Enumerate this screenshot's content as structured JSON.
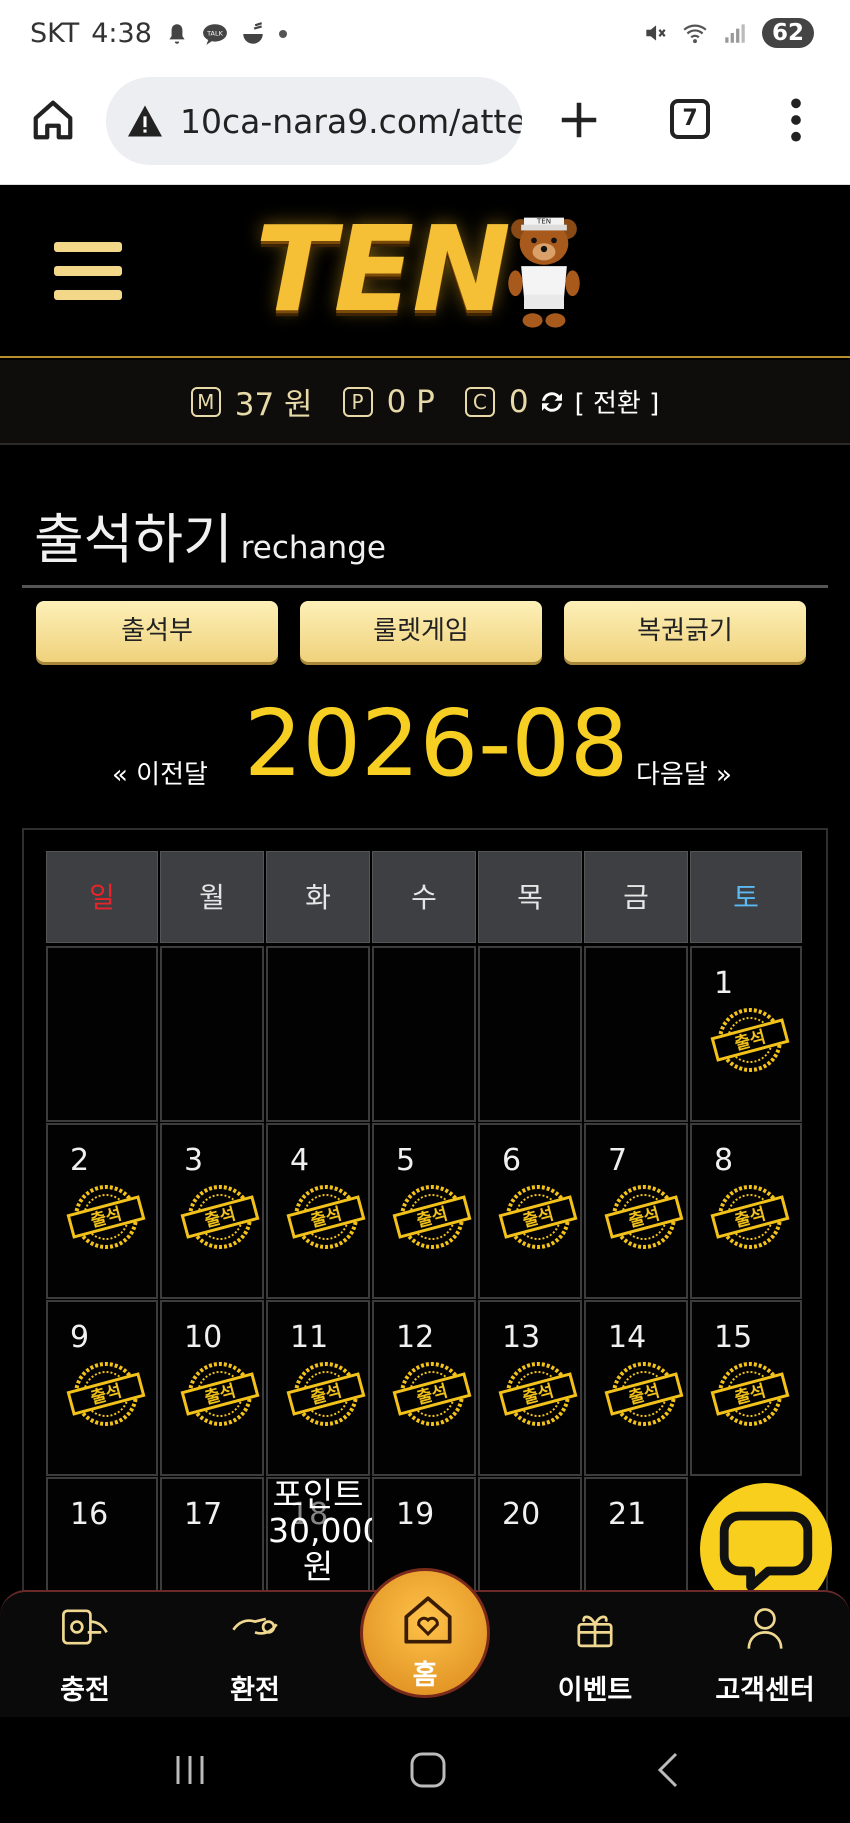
{
  "status_bar": {
    "carrier": "SKT",
    "time": "4:38",
    "battery": "62",
    "left_icons": [
      "bell-icon",
      "talk-icon",
      "bowl-icon",
      "dot-icon"
    ],
    "right_icons": [
      "mute-icon",
      "wifi-icon",
      "signal-icon"
    ]
  },
  "browser": {
    "url": "10ca-nara9.com/atte",
    "tab_count": "7"
  },
  "site": {
    "logo_text": "TEN",
    "bear_badge": "TEN"
  },
  "points": {
    "money_badge": "M",
    "money_value": "37 원",
    "point_badge": "P",
    "point_value": "0 P",
    "coin_badge": "C",
    "coin_value": "0",
    "switch_label": "[ 전환 ]"
  },
  "page": {
    "title": "출석하기",
    "subtitle": "rechange"
  },
  "tabs": [
    {
      "label": "출석부"
    },
    {
      "label": "룰렛게임"
    },
    {
      "label": "복권긁기"
    }
  ],
  "calendar": {
    "prev_label": "« 이전달",
    "month": "2026-08",
    "next_label": "다음달 »",
    "weekdays": [
      "일",
      "월",
      "화",
      "수",
      "목",
      "금",
      "토"
    ],
    "weekday_colors": {
      "sunday": "#e8242a",
      "saturday": "#5cb8f0",
      "default": "#e6e6e6"
    },
    "stamp_text": "출석",
    "stamp_color": "#f2c21b",
    "days": [
      {
        "day": "1",
        "stamped": true
      },
      {
        "day": "2",
        "stamped": true
      },
      {
        "day": "3",
        "stamped": true
      },
      {
        "day": "4",
        "stamped": true
      },
      {
        "day": "5",
        "stamped": true
      },
      {
        "day": "6",
        "stamped": true
      },
      {
        "day": "7",
        "stamped": true
      },
      {
        "day": "8",
        "stamped": true
      },
      {
        "day": "9",
        "stamped": true
      },
      {
        "day": "10",
        "stamped": true
      },
      {
        "day": "11",
        "stamped": true
      },
      {
        "day": "12",
        "stamped": true
      },
      {
        "day": "13",
        "stamped": true
      },
      {
        "day": "14",
        "stamped": true
      },
      {
        "day": "15",
        "stamped": true
      },
      {
        "day": "16",
        "stamped": false
      },
      {
        "day": "17",
        "stamped": false
      },
      {
        "day": "18",
        "stamped": false
      },
      {
        "day": "19",
        "stamped": false
      },
      {
        "day": "20",
        "stamped": false
      },
      {
        "day": "21",
        "stamped": false
      }
    ],
    "reward_day_18": [
      "포인트",
      "30,000",
      "원"
    ]
  },
  "bottom_nav": [
    {
      "label": "충전",
      "icon": "charge-icon"
    },
    {
      "label": "환전",
      "icon": "exchange-icon"
    },
    {
      "label": "홈",
      "icon": "home-heart-icon"
    },
    {
      "label": "이벤트",
      "icon": "gift-icon"
    },
    {
      "label": "고객센터",
      "icon": "support-icon"
    }
  ],
  "chat": {
    "icon": "chat-bubble-icon"
  },
  "accent_color": "#f7cf23"
}
